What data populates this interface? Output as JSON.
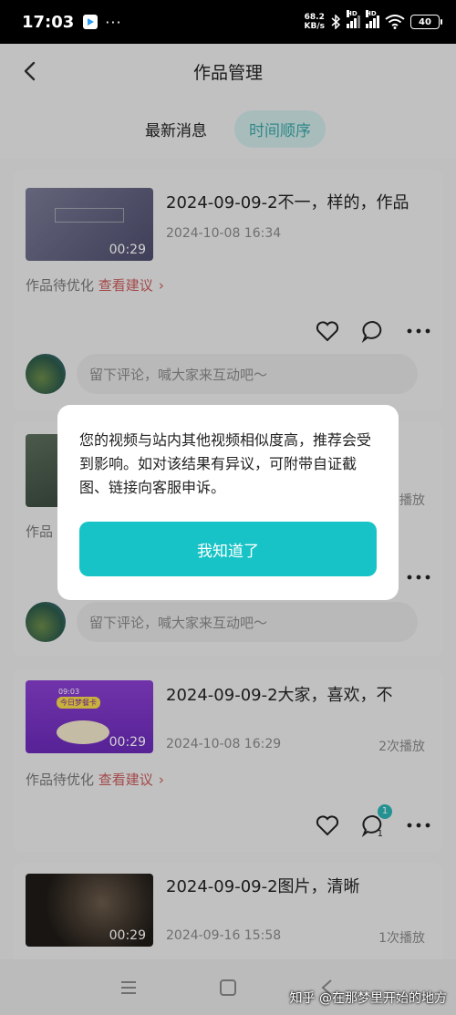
{
  "status_bar": {
    "time": "17:03",
    "dots": "···",
    "speed_value": "68.2",
    "speed_unit": "KB/s",
    "sim1_label": "HD",
    "sim2_label": "HD",
    "battery": "40"
  },
  "header": {
    "title": "作品管理"
  },
  "tabs": [
    {
      "label": "最新消息",
      "active": false
    },
    {
      "label": "时间顺序",
      "active": true
    }
  ],
  "cards": [
    {
      "title": "2024-09-09-2不一，样的，作品",
      "date": "2024-10-08 16:34",
      "plays": "",
      "duration": "00:29",
      "optimize_label": "作品待优化",
      "suggest_link": "查看建议",
      "comment_placeholder": "留下评论，喊大家来互动吧～"
    },
    {
      "title": "",
      "date": "",
      "plays": "播放",
      "duration": "",
      "optimize_label": "作品",
      "suggest_link": "",
      "comment_placeholder": "留下评论，喊大家来互动吧～"
    },
    {
      "title": "2024-09-09-2大家，喜欢，不",
      "date": "2024-10-08 16:29",
      "plays": "2次播放",
      "duration": "00:29",
      "optimize_label": "作品待优化",
      "suggest_link": "查看建议",
      "comment_badge": "1",
      "comment_count": "1"
    },
    {
      "title": "2024-09-09-2图片，清晰",
      "date": "2024-09-16 15:58",
      "plays": "1次播放",
      "duration": "00:29"
    }
  ],
  "thumb_texts": {
    "card3_banner": "今日梦餐卡",
    "card3_time": "09:03"
  },
  "dialog": {
    "message": "您的视频与站内其他视频相似度高，推荐会受到影响。如对该结果有异议，可附带自证截图、链接向客服申诉。",
    "ok_label": "我知道了"
  },
  "watermark": "知乎 @在那梦里开始的地方",
  "colors": {
    "accent": "#17c3c6",
    "tab_active_bg": "#cfe6e6",
    "tab_active_text": "#3aa7a7",
    "link_red": "#c85a5a"
  }
}
